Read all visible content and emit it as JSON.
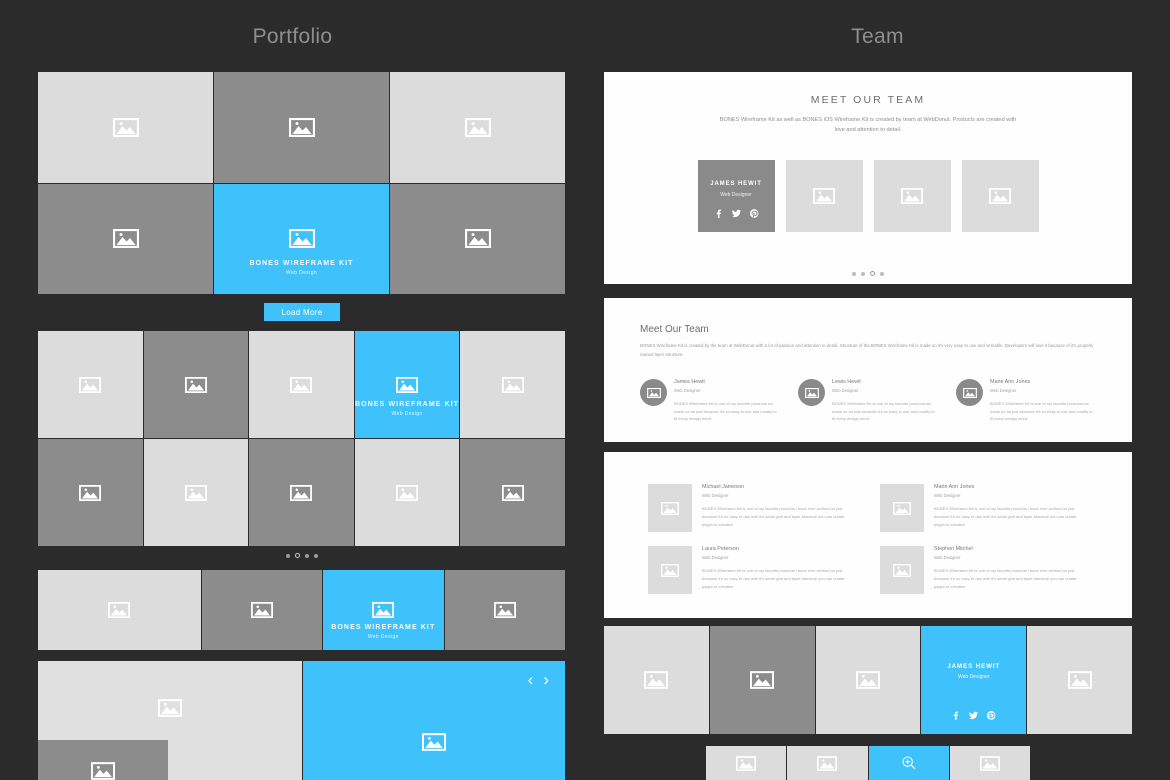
{
  "columns": {
    "portfolio_title": "Portfolio",
    "team_title": "Team"
  },
  "colors": {
    "background": "#2b2b2b",
    "accent": "#3fc1fb",
    "light": "#dcdcdc",
    "dark": "#8c8c8c",
    "panel": "#fefefe"
  },
  "portfolio": {
    "grid1": {
      "tiles": [
        {
          "tone": "l",
          "caption": "",
          "sub": ""
        },
        {
          "tone": "d",
          "caption": "",
          "sub": ""
        },
        {
          "tone": "l",
          "caption": "",
          "sub": ""
        },
        {
          "tone": "d",
          "caption": "",
          "sub": ""
        },
        {
          "tone": "b",
          "caption": "BONES WIREFRAME KIT",
          "sub": "Web Design"
        },
        {
          "tone": "d",
          "caption": "",
          "sub": ""
        }
      ]
    },
    "load_more_label": "Load More",
    "grid2": {
      "tiles": [
        {
          "tone": "l",
          "caption": "",
          "sub": ""
        },
        {
          "tone": "d",
          "caption": "",
          "sub": ""
        },
        {
          "tone": "l",
          "caption": "",
          "sub": ""
        },
        {
          "tone": "b",
          "caption": "BONES WIREFRAME KIT",
          "sub": "Web Design"
        },
        {
          "tone": "l",
          "caption": "",
          "sub": ""
        },
        {
          "tone": "d",
          "caption": "",
          "sub": ""
        },
        {
          "tone": "l",
          "caption": "",
          "sub": ""
        },
        {
          "tone": "d",
          "caption": "",
          "sub": ""
        },
        {
          "tone": "l",
          "caption": "",
          "sub": ""
        },
        {
          "tone": "d",
          "caption": "",
          "sub": ""
        }
      ],
      "dots": {
        "count": 4,
        "active_index": 1
      }
    },
    "grid3": {
      "tiles": [
        {
          "tone": "l",
          "caption": "",
          "sub": ""
        },
        {
          "tone": "d",
          "caption": "",
          "sub": ""
        },
        {
          "tone": "b",
          "caption": "BONES WIREFRAME KIT",
          "sub": "Web Design"
        },
        {
          "tone": "d",
          "caption": "",
          "sub": ""
        }
      ]
    },
    "grid4": {
      "prev_arrow": "‹",
      "next_arrow": "›"
    }
  },
  "team": {
    "panel1": {
      "heading": "MEET OUR TEAM",
      "intro": "BONES Wireframe Kit as well as BONES iOS Wireframe Kit is created by team at WebDonut. Products are created with love and attention to detail.",
      "cards": [
        {
          "name": "JAMES HEWIT",
          "role": "Web Designer",
          "active": true
        },
        {
          "name": "",
          "role": "",
          "active": false
        },
        {
          "name": "",
          "role": "",
          "active": false
        },
        {
          "name": "",
          "role": "",
          "active": false
        }
      ],
      "socials": [
        "f",
        "🐦",
        "𝒫"
      ],
      "dots": {
        "count": 4,
        "active_index": 2
      }
    },
    "panel2": {
      "heading": "Meet Our Team",
      "lead": "BONES Wireframe Kit is created by the team at WebDonut with a lot of passion and attention to detail. Structure of the BONES Wireframe Kit is made so it's very easy to use and versatile. Developers will love it because of it's properly named layer structure.",
      "members": [
        {
          "name": "James Hewit",
          "role": "Web Designer",
          "desc": "BONES Wireframe Kit is one of my favorite products we made so far just because it's so easy to use and modify to fit every design need."
        },
        {
          "name": "Lewis Hewit",
          "role": "Web Designer",
          "desc": "BONES Wireframe Kit is one of my favorite products we made so far just because it's so easy to use and modify to fit every design need."
        },
        {
          "name": "Marie Ann Jones",
          "role": "Web Designer",
          "desc": "BONES Wireframe Kit is one of my favorite products we made so far just because it's so easy to use and modify to fit every design need."
        }
      ]
    },
    "panel3": {
      "members": [
        {
          "name": "Michael Jameson",
          "role": "Web Designer",
          "desc": "BONES Wireframe Kit is one of my favorite products I have ever worked on just because it's so easy to use with it's smart grid and layer structure you can create pages in minutes!"
        },
        {
          "name": "Marie Ann Jones",
          "role": "Web Designer",
          "desc": "BONES Wireframe Kit is one of my favorite products I have ever worked on just because it's so easy to use with it's smart grid and layer structure you can create pages in minutes!"
        },
        {
          "name": "Laura Peterson",
          "role": "Web Designer",
          "desc": "BONES Wireframe Kit is one of my favorite products I have ever worked on just because it's so easy to use with it's smart grid and layer structure you can create pages in minutes!"
        },
        {
          "name": "Stephen Mitchel",
          "role": "Web Designer",
          "desc": "BONES Wireframe Kit is one of my favorite products I have ever worked on just because it's so easy to use with it's smart grid and layer structure you can create pages in minutes!"
        }
      ]
    },
    "panel4": {
      "tiles": [
        {
          "tone": "l",
          "name": "",
          "role": ""
        },
        {
          "tone": "d",
          "name": "",
          "role": ""
        },
        {
          "tone": "l",
          "name": "",
          "role": ""
        },
        {
          "tone": "b",
          "name": "JAMES HEWIT",
          "role": "Web Designer"
        },
        {
          "tone": "l",
          "name": "",
          "role": ""
        }
      ],
      "socials": [
        "f",
        "🐦",
        "𝒫"
      ]
    },
    "thumbs": {
      "tiles": [
        {
          "tone": "l",
          "icon": "image-placeholder-icon"
        },
        {
          "tone": "l",
          "icon": "image-placeholder-icon"
        },
        {
          "tone": "b",
          "icon": "zoom-in-icon"
        },
        {
          "tone": "l",
          "icon": "image-placeholder-icon"
        }
      ]
    }
  }
}
